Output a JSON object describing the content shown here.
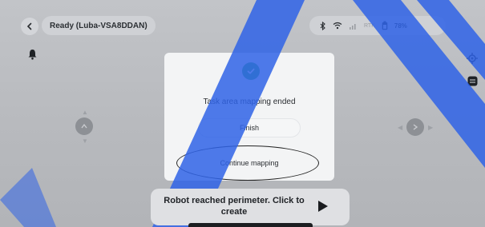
{
  "topbar": {
    "back_icon": "chevron-left-icon",
    "status": "Ready  (Luba-VSA8DDAN)",
    "indicators": {
      "bluetooth_icon": "bluetooth-icon",
      "wifi_icon": "wifi-icon",
      "cellular_icon": "cellular-icon",
      "rtk_label": "RTK",
      "battery_icon": "battery-icon",
      "battery": "78%"
    }
  },
  "modal": {
    "success_icon": "check-circle-icon",
    "title": "Task area mapping ended",
    "finish_label": "Finish",
    "continue_label": "Continue mapping"
  },
  "toast": {
    "message": "Robot reached perimeter. Click to create",
    "play_icon": "play-icon"
  },
  "colors": {
    "success": "#38b56a",
    "watermark": "#2f63e6",
    "modal_bg": "#f3f4f5",
    "overlay": "#b9bbbf"
  }
}
